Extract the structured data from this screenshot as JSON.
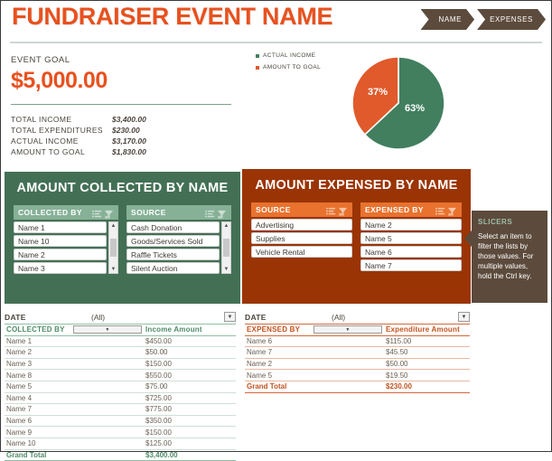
{
  "header": {
    "title": "FUNDRAISER EVENT NAME",
    "buttons": [
      {
        "label": "NAME"
      },
      {
        "label": "EXPENSES"
      }
    ]
  },
  "summary": {
    "goal_label": "EVENT GOAL",
    "goal_amount": "$5,000.00",
    "rows": [
      {
        "label": "TOTAL INCOME",
        "value": "$3,400.00"
      },
      {
        "label": "TOTAL EXPENDITURES",
        "value": "$230.00"
      },
      {
        "label": "ACTUAL INCOME",
        "value": "$3,170.00"
      },
      {
        "label": "AMOUNT TO GOAL",
        "value": "$1,830.00"
      }
    ]
  },
  "chart_data": {
    "type": "pie",
    "title": "",
    "categories": [
      "ACTUAL INCOME",
      "AMOUNT TO GOAL"
    ],
    "values": [
      63,
      37
    ],
    "value_labels": [
      "63%",
      "37%"
    ],
    "colors": [
      "#417f5f",
      "#e05a2b"
    ],
    "legend": "top-left",
    "legend_entries": [
      {
        "label": "ACTUAL INCOME",
        "color": "#417f5f"
      },
      {
        "label": "AMOUNT TO GOAL",
        "color": "#e05a2b"
      }
    ]
  },
  "collected_panel": {
    "title": "AMOUNT COLLECTED BY NAME",
    "bg": "#437055",
    "slicers": [
      {
        "title": "COLLECTED BY",
        "multi_icon": "multi-select-icon",
        "clear_icon": "clear-filter-icon",
        "items": [
          "Name 1",
          "Name 10",
          "Name 2",
          "Name 3"
        ],
        "has_scrollbar": true
      },
      {
        "title": "SOURCE",
        "multi_icon": "multi-select-icon",
        "clear_icon": "clear-filter-icon",
        "items": [
          "Cash Donation",
          "Goods/Services Sold",
          "Raffle Tickets",
          "Silent Auction"
        ],
        "has_scrollbar": true
      }
    ]
  },
  "expensed_panel": {
    "title": "AMOUNT EXPENSED BY NAME",
    "bg": "#9b3404",
    "slicers": [
      {
        "title": "SOURCE",
        "multi_icon": "multi-select-icon",
        "clear_icon": "clear-filter-icon",
        "items": [
          "Advertising",
          "Supplies",
          "Vehicle Rental"
        ],
        "has_scrollbar": false
      },
      {
        "title": "EXPENSED BY",
        "multi_icon": "multi-select-icon",
        "clear_icon": "clear-filter-icon",
        "items": [
          "Name 2",
          "Name 5",
          "Name 6",
          "Name 7"
        ],
        "has_scrollbar": false
      }
    ]
  },
  "tip": {
    "title": "SLICERS",
    "body": "Select an item to filter the lists by those values. For multiple values, hold the Ctrl key."
  },
  "income_table": {
    "filter_label": "DATE",
    "filter_value": "(All)",
    "columns": [
      "COLLECTED BY",
      "Income Amount"
    ],
    "rows": [
      [
        "Name 1",
        "$450.00"
      ],
      [
        "Name 2",
        "$50.00"
      ],
      [
        "Name 3",
        "$150.00"
      ],
      [
        "Name 8",
        "$550.00"
      ],
      [
        "Name 5",
        "$75.00"
      ],
      [
        "Name 4",
        "$725.00"
      ],
      [
        "Name 7",
        "$775.00"
      ],
      [
        "Name 6",
        "$350.00"
      ],
      [
        "Name 9",
        "$150.00"
      ],
      [
        "Name 10",
        "$125.00"
      ]
    ],
    "total": [
      "Grand Total",
      "$3,400.00"
    ]
  },
  "expense_table": {
    "filter_label": "DATE",
    "filter_value": "(All)",
    "columns": [
      "EXPENSED BY",
      "Expenditure Amount"
    ],
    "rows": [
      [
        "Name 6",
        "$115.00"
      ],
      [
        "Name 7",
        "$45.50"
      ],
      [
        "Name 2",
        "$50.00"
      ],
      [
        "Name 5",
        "$19.50"
      ]
    ],
    "total": [
      "Grand Total",
      "$230.00"
    ]
  }
}
